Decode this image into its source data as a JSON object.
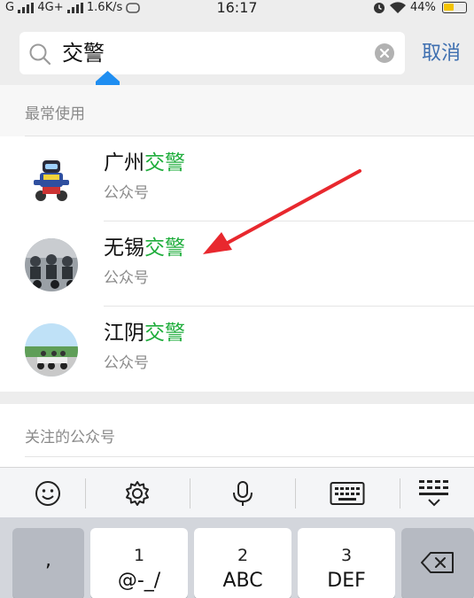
{
  "status_bar": {
    "carrier": "G",
    "network": "4G+",
    "speed": "1.6K/s",
    "time": "16:17",
    "battery": "44%"
  },
  "search": {
    "query": "交警",
    "cancel_label": "取消"
  },
  "sections": {
    "frequent": "最常使用",
    "followed": "关注的公众号"
  },
  "results": [
    {
      "name_prefix": "广州",
      "name_highlight": "交警",
      "type": "公众号"
    },
    {
      "name_prefix": "无锡",
      "name_highlight": "交警",
      "type": "公众号"
    },
    {
      "name_prefix": "江阴",
      "name_highlight": "交警",
      "type": "公众号"
    }
  ],
  "keyboard": {
    "tools": [
      "emoji-icon",
      "gear-icon",
      "microphone-icon",
      "keyboard-icon",
      "collapse-keyboard-icon"
    ],
    "keys": [
      {
        "num": "",
        "letters": ","
      },
      {
        "num": "1",
        "letters": "@-_/"
      },
      {
        "num": "2",
        "letters": "ABC"
      },
      {
        "num": "3",
        "letters": "DEF"
      }
    ]
  },
  "colors": {
    "highlight": "#1ead3b",
    "link": "#3e6fb0",
    "caret": "#1f8ef1",
    "annotation": "#e8282e"
  }
}
